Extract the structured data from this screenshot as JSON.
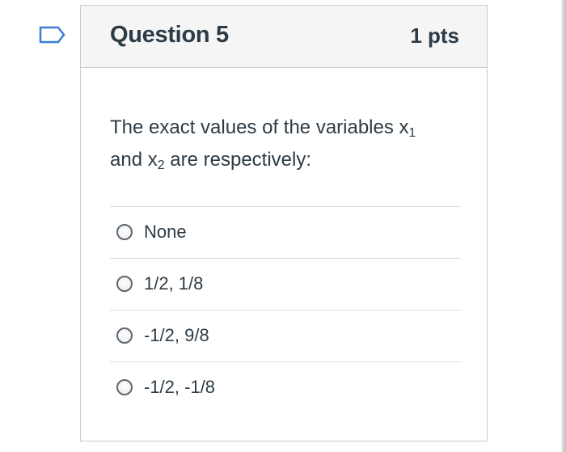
{
  "question": {
    "title": "Question 5",
    "points": "1 pts",
    "text": {
      "part1": "The exact values of the variables x",
      "sub1": "1",
      "part2": "and x",
      "sub2": "2",
      "part3": " are respectively:"
    },
    "answers": [
      {
        "label": "None",
        "selected": false
      },
      {
        "label": "1/2, 1/8",
        "selected": false
      },
      {
        "label": "-1/2, 9/8",
        "selected": false
      },
      {
        "label": "-1/2, -1/8",
        "selected": false
      }
    ]
  },
  "flag_icon": "bookmark-flag-icon",
  "colors": {
    "flag_border": "#3b7fd6",
    "header_bg": "#f5f5f5",
    "text": "#2d3b45",
    "border": "#c7cdd1"
  }
}
